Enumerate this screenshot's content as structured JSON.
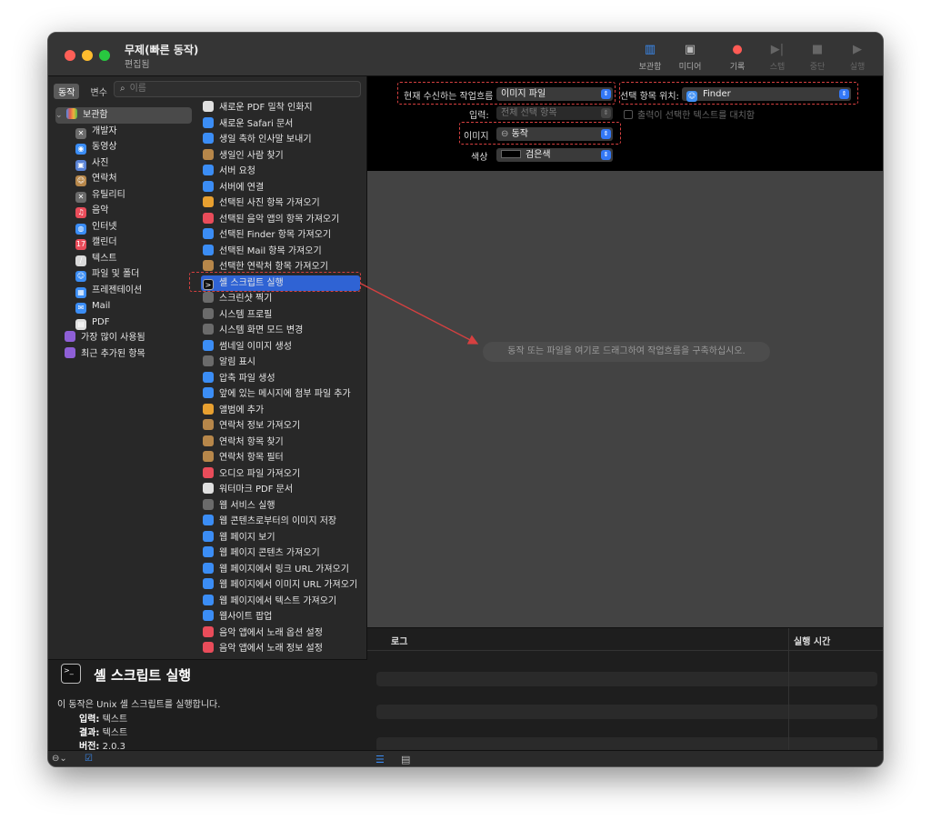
{
  "window": {
    "title": "무제(빠른 동작)",
    "subtitle": "편집됨"
  },
  "toolbar": {
    "library": "보관함",
    "media": "미디어",
    "record": "기록",
    "step": "스텝",
    "stop": "중단",
    "run": "실행"
  },
  "sidebar": {
    "tab_actions": "동작",
    "tab_variables": "변수",
    "search_placeholder": "이름",
    "library_root": "보관함",
    "library_items": [
      "개발자",
      "동영상",
      "사진",
      "연락처",
      "유틸리티",
      "음악",
      "인터넷",
      "캘린더",
      "텍스트",
      "파일 및 폴더",
      "프레젠테이션",
      "Mail",
      "PDF"
    ],
    "smart_groups": [
      "가장 많이 사용됨",
      "최근 추가된 항목"
    ]
  },
  "actions_list": [
    "새로운 PDF 밀착 인화지",
    "새로운 Safari 문서",
    "생일 축하 인사말 보내기",
    "생일인 사람 찾기",
    "서버 요청",
    "서버에 연결",
    "선택된 사진 항목 가져오기",
    "선택된 음악 앱의 항목 가져오기",
    "선택된 Finder 항목 가져오기",
    "선택된 Mail 항목 가져오기",
    "선택한 연락처 항목 가져오기",
    "셸 스크립트 실행",
    "스크린샷 찍기",
    "시스템 프로필",
    "시스템 화면 모드 변경",
    "썸네일 이미지 생성",
    "알림 표시",
    "압축 파일 생성",
    "앞에 있는 메시지에 첨부 파일 추가",
    "앨범에 추가",
    "연락처 정보 가져오기",
    "연락처 항목 찾기",
    "연락처 항목 필터",
    "오디오 파일 가져오기",
    "워터마크 PDF 문서",
    "웹 서비스 실행",
    "웹 콘텐츠로부터의 이미지 저장",
    "웹 페이지 보기",
    "웹 페이지 콘텐츠 가져오기",
    "웹 페이지에서 링크 URL 가져오기",
    "웹 페이지에서 이미지 URL 가져오기",
    "웹 페이지에서 텍스트 가져오기",
    "웹사이트 팝업",
    "음악 앱에서 노래 옵션 설정",
    "음악 앱에서 노래 정보 설정"
  ],
  "selected_action": "셸 스크립트 실행",
  "detail": {
    "title": "셸 스크립트 실행",
    "description": "이 동작은 Unix 셸 스크립트를 실행합니다.",
    "input_label": "입력:",
    "input_value": "텍스트",
    "result_label": "결과:",
    "result_value": "텍스트",
    "version_label": "버전:",
    "version_value": "2.0.3"
  },
  "workflow_header": {
    "receives_label": "현재 수신하는 작업흐름",
    "receives_value": "이미지 파일",
    "location_label": "선택 항목 위치:",
    "location_value": "Finder",
    "input_label": "입력:",
    "input_value": "전체 선택 항목",
    "replace_label": "출력이 선택한 텍스트를 대치함",
    "image_label": "이미지",
    "image_value": "동작",
    "color_label": "색상",
    "color_value": "검은색"
  },
  "canvas": {
    "hint": "동작 또는 파일을 여기로 드래그하여 작업흐름을 구축하십시오."
  },
  "log": {
    "col_log": "로그",
    "col_time": "실행 시간"
  },
  "colors": {
    "accent": "#2f63d4",
    "annotation": "#d64040"
  }
}
